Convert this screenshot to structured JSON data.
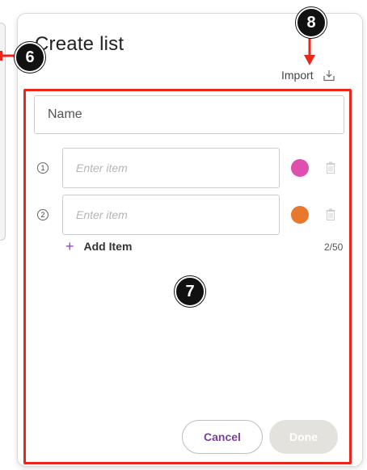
{
  "dialog": {
    "title": "Create list",
    "import_label": "Import",
    "name_placeholder": "Name",
    "items": [
      {
        "index": "1",
        "placeholder": "Enter item",
        "color": "#e04fb0"
      },
      {
        "index": "2",
        "placeholder": "Enter item",
        "color": "#e8782e"
      }
    ],
    "add_item_label": "Add Item",
    "counter": "2/50",
    "cancel_label": "Cancel",
    "done_label": "Done"
  },
  "annotations": {
    "badge_6": "6",
    "badge_7": "7",
    "badge_8": "8",
    "highlight_color": "#e8261b"
  },
  "icons": {
    "import": "download-tray-icon",
    "delete": "trash-icon",
    "add": "plus-icon"
  }
}
